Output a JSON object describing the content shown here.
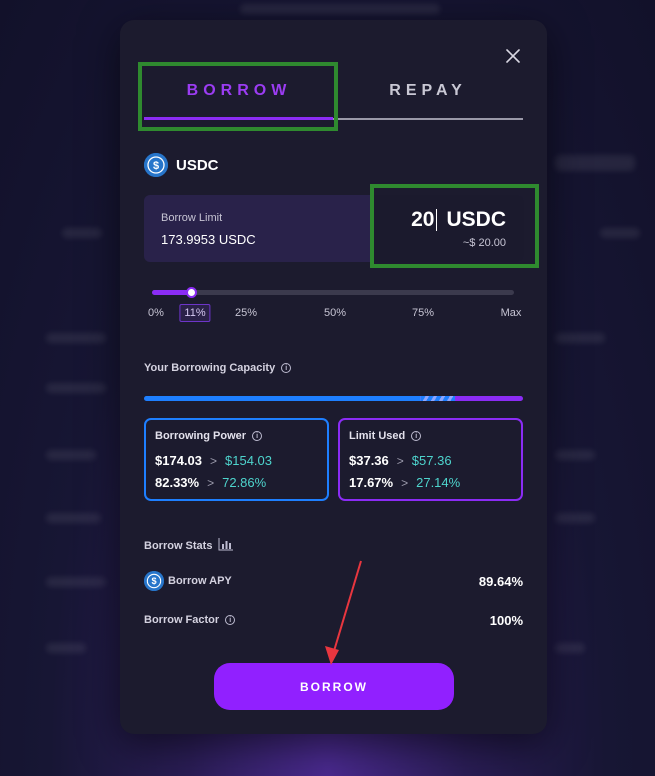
{
  "modal": {
    "tabs": [
      {
        "label": "BORROW",
        "active": true
      },
      {
        "label": "REPAY",
        "active": false
      }
    ],
    "asset": {
      "symbol": "USDC",
      "icon": "usdc-coin-icon"
    },
    "borrow_limit": {
      "label": "Borrow Limit",
      "value": "173.9953 USDC"
    },
    "amount_input": {
      "value": "20",
      "unit": "USDC",
      "usd_value": "~$ 20.00"
    },
    "slider": {
      "percent": 11,
      "labels": [
        "0%",
        "11%",
        "25%",
        "50%",
        "75%",
        "Max"
      ],
      "active_label": "11%"
    },
    "capacity": {
      "title": "Your Borrowing Capacity"
    },
    "borrowing_power": {
      "title": "Borrowing Power",
      "current_amount": "$174.03",
      "new_amount": "$154.03",
      "current_pct": "82.33%",
      "new_pct": "72.86%"
    },
    "limit_used": {
      "title": "Limit Used",
      "current_amount": "$37.36",
      "new_amount": "$57.36",
      "current_pct": "17.67%",
      "new_pct": "27.14%"
    },
    "borrow_stats": {
      "title": "Borrow Stats",
      "apy_label": "Borrow APY",
      "apy_value": "89.64%",
      "factor_label": "Borrow Factor",
      "factor_value": "100%"
    },
    "action_button": {
      "label": "BORROW"
    }
  },
  "colors": {
    "accent": "#8b2cf5",
    "blue": "#1e7fff",
    "teal": "#4ed4cd",
    "highlight": "#2f8a2f",
    "annotation": "#e8363f"
  }
}
